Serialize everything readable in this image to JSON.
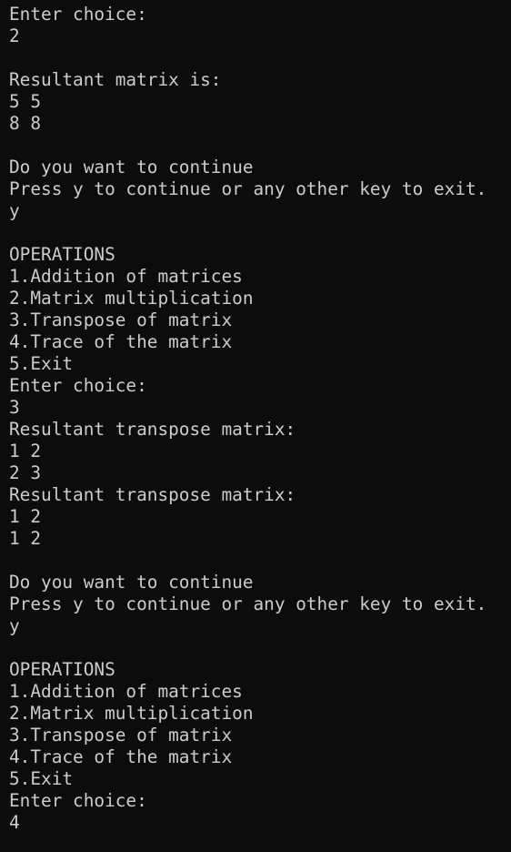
{
  "terminal": {
    "background": "#0c0c0c",
    "foreground": "#cccccc",
    "lines": [
      "Enter choice:",
      "2",
      "",
      "Resultant matrix is:",
      "5 5",
      "8 8",
      "",
      "Do you want to continue",
      "Press y to continue or any other key to exit.",
      "y",
      "",
      "OPERATIONS",
      "1.Addition of matrices",
      "2.Matrix multiplication",
      "3.Transpose of matrix",
      "4.Trace of the matrix",
      "5.Exit",
      "Enter choice:",
      "3",
      "Resultant transpose matrix:",
      "1 2",
      "2 3",
      "Resultant transpose matrix:",
      "1 2",
      "1 2",
      "",
      "Do you want to continue",
      "Press y to continue or any other key to exit.",
      "y",
      "",
      "OPERATIONS",
      "1.Addition of matrices",
      "2.Matrix multiplication",
      "3.Transpose of matrix",
      "4.Trace of the matrix",
      "5.Exit",
      "Enter choice:",
      "4"
    ]
  }
}
